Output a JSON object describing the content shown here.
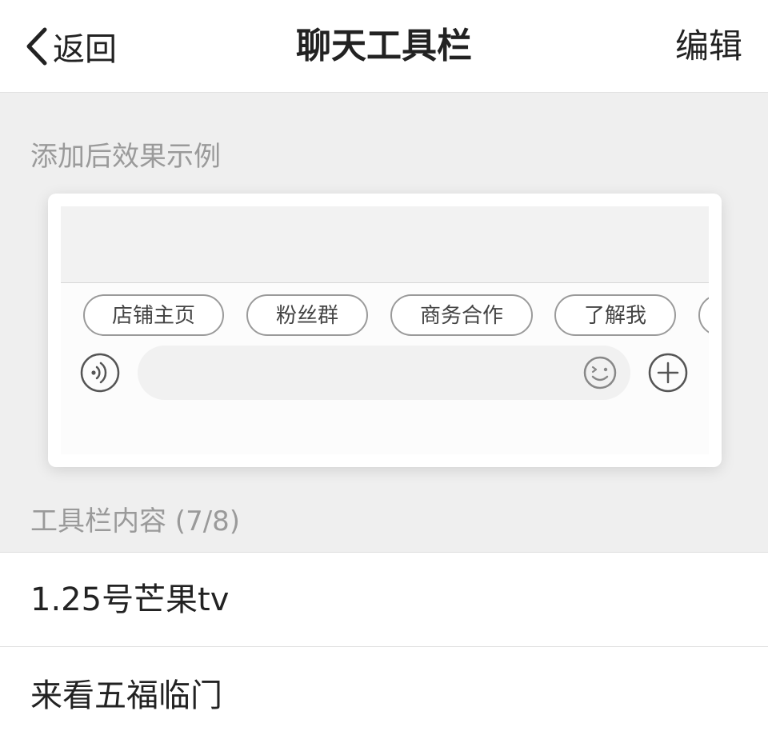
{
  "nav": {
    "back_label": "返回",
    "title": "聊天工具栏",
    "edit_label": "编辑"
  },
  "preview": {
    "label": "添加后效果示例",
    "chips": [
      "店铺主页",
      "粉丝群",
      "商务合作",
      "了解我"
    ]
  },
  "content": {
    "label": "工具栏内容 (7/8)",
    "items": [
      "1.25号芒果tv",
      "来看五福临门"
    ]
  },
  "icons": {
    "back": "chevron-left-icon",
    "voice": "voice-icon",
    "emoji": "emoji-icon",
    "plus": "plus-icon"
  }
}
